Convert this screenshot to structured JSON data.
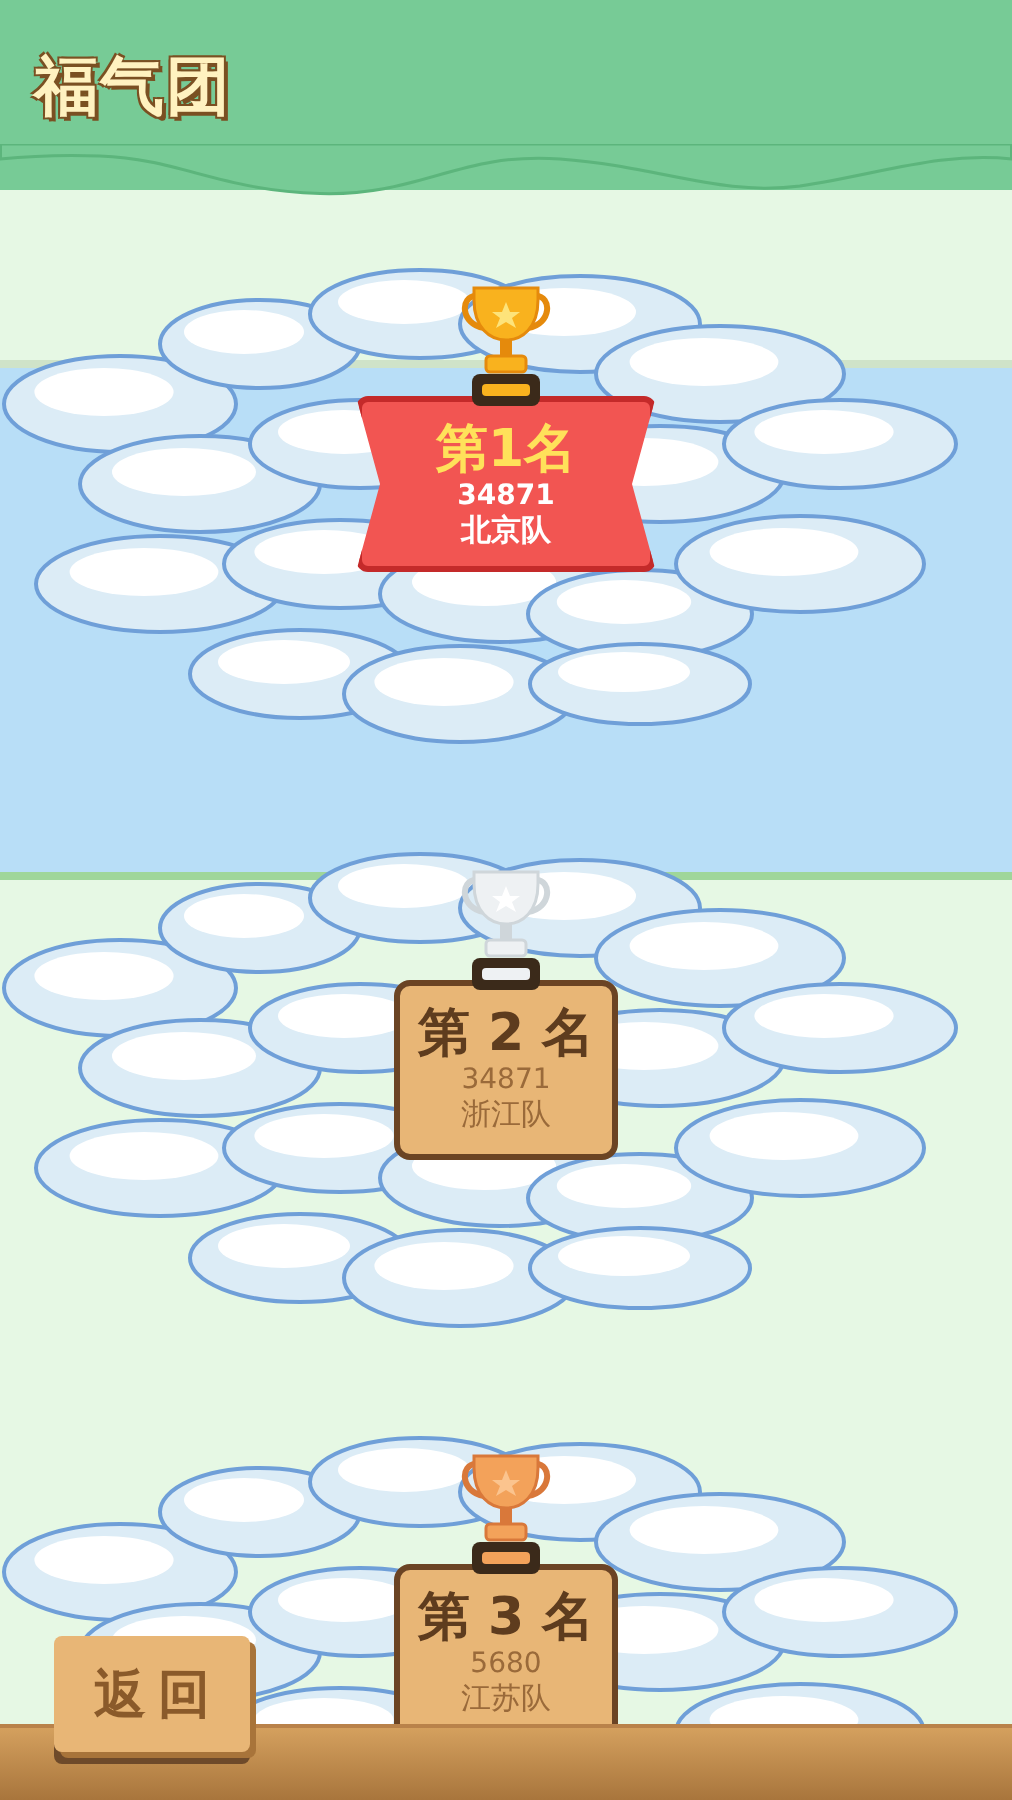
{
  "header": {
    "title": "福气团"
  },
  "ranks": [
    {
      "kind": "gold",
      "rank": "第1名",
      "score": "34871",
      "team": "北京队"
    },
    {
      "kind": "silver",
      "rank": "第 2 名",
      "score": "34871",
      "team": "浙江队"
    },
    {
      "kind": "bronze",
      "rank": "第 3 名",
      "score": "5680",
      "team": "江苏队"
    }
  ],
  "back_button": {
    "label": "返回"
  }
}
